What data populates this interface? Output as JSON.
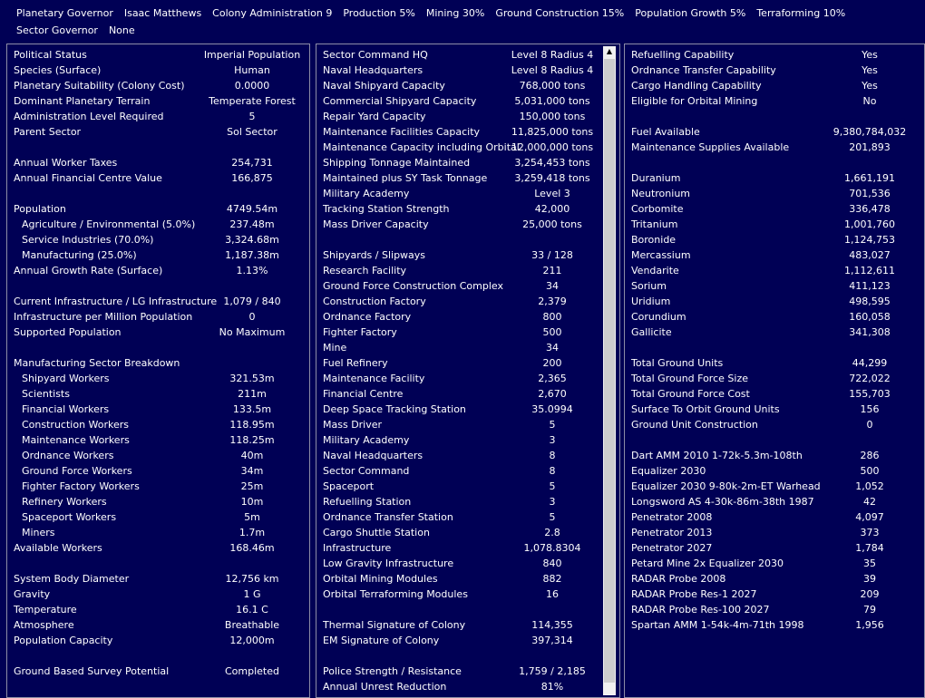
{
  "header": {
    "row1": [
      "Planetary Governor",
      "Isaac Matthews",
      "Colony Administration 9",
      "Production 5%",
      "Mining 30%",
      "Ground Construction 15%",
      "Population Growth 5%",
      "Terraforming 10%"
    ],
    "row2": [
      "Sector Governor",
      "None"
    ]
  },
  "panel1": [
    {
      "label": "Political Status",
      "value": "Imperial Population"
    },
    {
      "label": "Species (Surface)",
      "value": "Human"
    },
    {
      "label": "Planetary Suitability (Colony Cost)",
      "value": "0.0000"
    },
    {
      "label": "Dominant Planetary Terrain",
      "value": "Temperate Forest"
    },
    {
      "label": "Administration Level Required",
      "value": "5"
    },
    {
      "label": "Parent Sector",
      "value": "Sol Sector"
    },
    {
      "label": "",
      "value": ""
    },
    {
      "label": "Annual Worker Taxes",
      "value": "254,731"
    },
    {
      "label": "Annual Financial Centre Value",
      "value": "166,875"
    },
    {
      "label": "",
      "value": ""
    },
    {
      "label": "Population",
      "value": "4749.54m"
    },
    {
      "label": "Agriculture / Environmental (5.0%)",
      "value": "237.48m",
      "indent": true
    },
    {
      "label": "Service Industries (70.0%)",
      "value": "3,324.68m",
      "indent": true
    },
    {
      "label": "Manufacturing (25.0%)",
      "value": "1,187.38m",
      "indent": true
    },
    {
      "label": "Annual Growth Rate (Surface)",
      "value": "1.13%"
    },
    {
      "label": "",
      "value": ""
    },
    {
      "label": "Current Infrastructure / LG Infrastructure",
      "value": "1,079 / 840"
    },
    {
      "label": "Infrastructure per Million Population",
      "value": "0"
    },
    {
      "label": "Supported Population",
      "value": "No Maximum"
    },
    {
      "label": "",
      "value": ""
    },
    {
      "label": "Manufacturing Sector Breakdown",
      "value": ""
    },
    {
      "label": "Shipyard Workers",
      "value": "321.53m",
      "indent": true
    },
    {
      "label": "Scientists",
      "value": "211m",
      "indent": true
    },
    {
      "label": "Financial Workers",
      "value": "133.5m",
      "indent": true
    },
    {
      "label": "Construction Workers",
      "value": "118.95m",
      "indent": true
    },
    {
      "label": "Maintenance Workers",
      "value": "118.25m",
      "indent": true
    },
    {
      "label": "Ordnance Workers",
      "value": "40m",
      "indent": true
    },
    {
      "label": "Ground Force Workers",
      "value": "34m",
      "indent": true
    },
    {
      "label": "Fighter Factory Workers",
      "value": "25m",
      "indent": true
    },
    {
      "label": "Refinery Workers",
      "value": "10m",
      "indent": true
    },
    {
      "label": "Spaceport Workers",
      "value": "5m",
      "indent": true
    },
    {
      "label": "Miners",
      "value": "1.7m",
      "indent": true
    },
    {
      "label": "Available Workers",
      "value": "168.46m"
    },
    {
      "label": "",
      "value": ""
    },
    {
      "label": "System Body Diameter",
      "value": "12,756 km"
    },
    {
      "label": "Gravity",
      "value": "1 G"
    },
    {
      "label": "Temperature",
      "value": "16.1 C"
    },
    {
      "label": "Atmosphere",
      "value": "Breathable"
    },
    {
      "label": "Population Capacity",
      "value": "12,000m"
    },
    {
      "label": "",
      "value": ""
    },
    {
      "label": "Ground Based Survey Potential",
      "value": "Completed"
    }
  ],
  "panel2": [
    {
      "label": "Sector Command HQ",
      "value": "Level 8  Radius 4"
    },
    {
      "label": "Naval Headquarters",
      "value": "Level 8  Radius 4"
    },
    {
      "label": "Naval Shipyard Capacity",
      "value": "768,000 tons"
    },
    {
      "label": "Commercial Shipyard Capacity",
      "value": "5,031,000 tons"
    },
    {
      "label": "Repair Yard Capacity",
      "value": "150,000 tons"
    },
    {
      "label": "Maintenance Facilities Capacity",
      "value": "11,825,000 tons"
    },
    {
      "label": "Maintenance Capacity including Orbital",
      "value": "12,000,000 tons"
    },
    {
      "label": "Shipping Tonnage Maintained",
      "value": "3,254,453 tons"
    },
    {
      "label": "Maintained plus SY Task Tonnage",
      "value": "3,259,418 tons"
    },
    {
      "label": "Military Academy",
      "value": "Level 3"
    },
    {
      "label": "Tracking Station Strength",
      "value": "42,000"
    },
    {
      "label": "Mass Driver Capacity",
      "value": "25,000 tons"
    },
    {
      "label": "",
      "value": ""
    },
    {
      "label": "Shipyards / Slipways",
      "value": "33 / 128"
    },
    {
      "label": "Research Facility",
      "value": "211"
    },
    {
      "label": "Ground Force Construction Complex",
      "value": "34"
    },
    {
      "label": "Construction Factory",
      "value": "2,379"
    },
    {
      "label": "Ordnance Factory",
      "value": "800"
    },
    {
      "label": "Fighter Factory",
      "value": "500"
    },
    {
      "label": "Mine",
      "value": "34"
    },
    {
      "label": "Fuel Refinery",
      "value": "200"
    },
    {
      "label": "Maintenance Facility",
      "value": "2,365"
    },
    {
      "label": "Financial Centre",
      "value": "2,670"
    },
    {
      "label": "Deep Space Tracking Station",
      "value": "35.0994"
    },
    {
      "label": "Mass Driver",
      "value": "5"
    },
    {
      "label": "Military Academy",
      "value": "3"
    },
    {
      "label": "Naval Headquarters",
      "value": "8"
    },
    {
      "label": "Sector Command",
      "value": "8"
    },
    {
      "label": "Spaceport",
      "value": "5"
    },
    {
      "label": "Refuelling Station",
      "value": "3"
    },
    {
      "label": "Ordnance Transfer Station",
      "value": "5"
    },
    {
      "label": "Cargo Shuttle Station",
      "value": "2.8"
    },
    {
      "label": "Infrastructure",
      "value": "1,078.8304"
    },
    {
      "label": "Low Gravity Infrastructure",
      "value": "840"
    },
    {
      "label": "Orbital Mining Modules",
      "value": "882"
    },
    {
      "label": "Orbital Terraforming Modules",
      "value": "16"
    },
    {
      "label": "",
      "value": ""
    },
    {
      "label": "Thermal Signature of Colony",
      "value": "114,355"
    },
    {
      "label": "EM Signature of Colony",
      "value": "397,314"
    },
    {
      "label": "",
      "value": ""
    },
    {
      "label": "Police Strength / Resistance",
      "value": "1,759 / 2,185"
    },
    {
      "label": "Annual Unrest Reduction",
      "value": "81%"
    }
  ],
  "panel3": [
    {
      "label": "Refuelling Capability",
      "value": "Yes"
    },
    {
      "label": "Ordnance Transfer Capability",
      "value": "Yes"
    },
    {
      "label": "Cargo Handling Capability",
      "value": "Yes"
    },
    {
      "label": "Eligible for Orbital Mining",
      "value": "No"
    },
    {
      "label": "",
      "value": ""
    },
    {
      "label": "Fuel Available",
      "value": "9,380,784,032"
    },
    {
      "label": "Maintenance Supplies Available",
      "value": "201,893"
    },
    {
      "label": "",
      "value": ""
    },
    {
      "label": "Duranium",
      "value": "1,661,191"
    },
    {
      "label": "Neutronium",
      "value": "701,536"
    },
    {
      "label": "Corbomite",
      "value": "336,478"
    },
    {
      "label": "Tritanium",
      "value": "1,001,760"
    },
    {
      "label": "Boronide",
      "value": "1,124,753"
    },
    {
      "label": "Mercassium",
      "value": "483,027"
    },
    {
      "label": "Vendarite",
      "value": "1,112,611"
    },
    {
      "label": "Sorium",
      "value": "411,123"
    },
    {
      "label": "Uridium",
      "value": "498,595"
    },
    {
      "label": "Corundium",
      "value": "160,058"
    },
    {
      "label": "Gallicite",
      "value": "341,308"
    },
    {
      "label": "",
      "value": ""
    },
    {
      "label": "Total Ground Units",
      "value": "44,299"
    },
    {
      "label": "Total Ground Force Size",
      "value": "722,022"
    },
    {
      "label": "Total Ground Force Cost",
      "value": "155,703"
    },
    {
      "label": "Surface To Orbit Ground Units",
      "value": "156"
    },
    {
      "label": "Ground Unit Construction",
      "value": "0"
    },
    {
      "label": "",
      "value": ""
    },
    {
      "label": "Dart AMM 2010 1-72k-5.3m-108th",
      "value": "286"
    },
    {
      "label": "Equalizer 2030",
      "value": "500"
    },
    {
      "label": "Equalizer 2030 9-80k-2m-ET Warhead",
      "value": "1,052"
    },
    {
      "label": "Longsword AS 4-30k-86m-38th 1987",
      "value": "42"
    },
    {
      "label": "Penetrator 2008",
      "value": "4,097"
    },
    {
      "label": "Penetrator 2013",
      "value": "373"
    },
    {
      "label": "Penetrator 2027",
      "value": "1,784"
    },
    {
      "label": "Petard Mine 2x Equalizer 2030",
      "value": "35"
    },
    {
      "label": "RADAR Probe 2008",
      "value": "39"
    },
    {
      "label": "RADAR Probe Res-1 2027",
      "value": "209"
    },
    {
      "label": "RADAR Probe Res-100 2027",
      "value": "79"
    },
    {
      "label": "Spartan AMM 1-54k-4m-71th 1998",
      "value": "1,956"
    }
  ]
}
